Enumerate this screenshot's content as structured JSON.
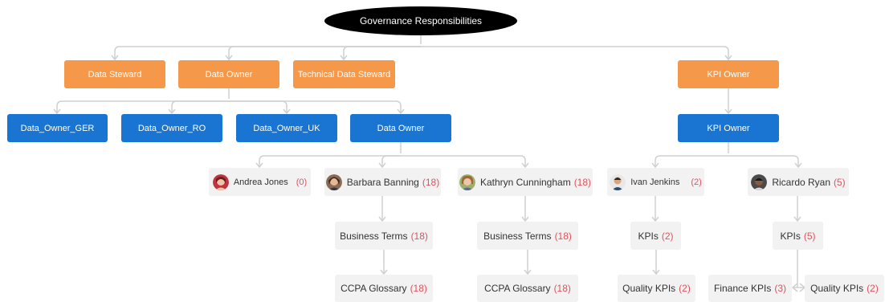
{
  "colors": {
    "root": "#000000",
    "role": "#f5984a",
    "group": "#1a75d2",
    "leaf": "#f2f2f2",
    "count": "#e0525b",
    "connector": "#d0d0d0"
  },
  "root": {
    "label": "Governance Responsibilities"
  },
  "roles": {
    "data_steward": "Data Steward",
    "data_owner": "Data Owner",
    "technical_data_steward": "Technical Data Steward",
    "kpi_owner": "KPI Owner"
  },
  "groups": {
    "ger": "Data_Owner_GER",
    "ro": "Data_Owner_RO",
    "uk": "Data_Owner_UK",
    "data_owner": "Data Owner",
    "kpi_owner": "KPI Owner"
  },
  "people": {
    "andrea": {
      "name": "Andrea Jones",
      "count": "(0)"
    },
    "barbara": {
      "name": "Barbara Banning",
      "count": "(18)"
    },
    "kathryn": {
      "name": "Kathryn Cunningham",
      "count": "(18)"
    },
    "ivan": {
      "name": "Ivan Jenkins",
      "count": "(2)"
    },
    "ricardo": {
      "name": "Ricardo Ryan",
      "count": "(5)"
    }
  },
  "categories": {
    "barbara_terms": {
      "label": "Business Terms",
      "count": "(18)"
    },
    "barbara_ccpa": {
      "label": "CCPA Glossary",
      "count": "(18)"
    },
    "kathryn_terms": {
      "label": "Business Terms",
      "count": "(18)"
    },
    "kathryn_ccpa": {
      "label": "CCPA Glossary",
      "count": "(18)"
    },
    "ivan_kpis": {
      "label": "KPIs",
      "count": "(2)"
    },
    "ivan_quality": {
      "label": "Quality KPIs",
      "count": "(2)"
    },
    "ricardo_kpis": {
      "label": "KPIs",
      "count": "(5)"
    },
    "ricardo_finance": {
      "label": "Finance KPIs",
      "count": "(3)"
    },
    "ricardo_quality": {
      "label": "Quality KPIs",
      "count": "(2)"
    }
  }
}
